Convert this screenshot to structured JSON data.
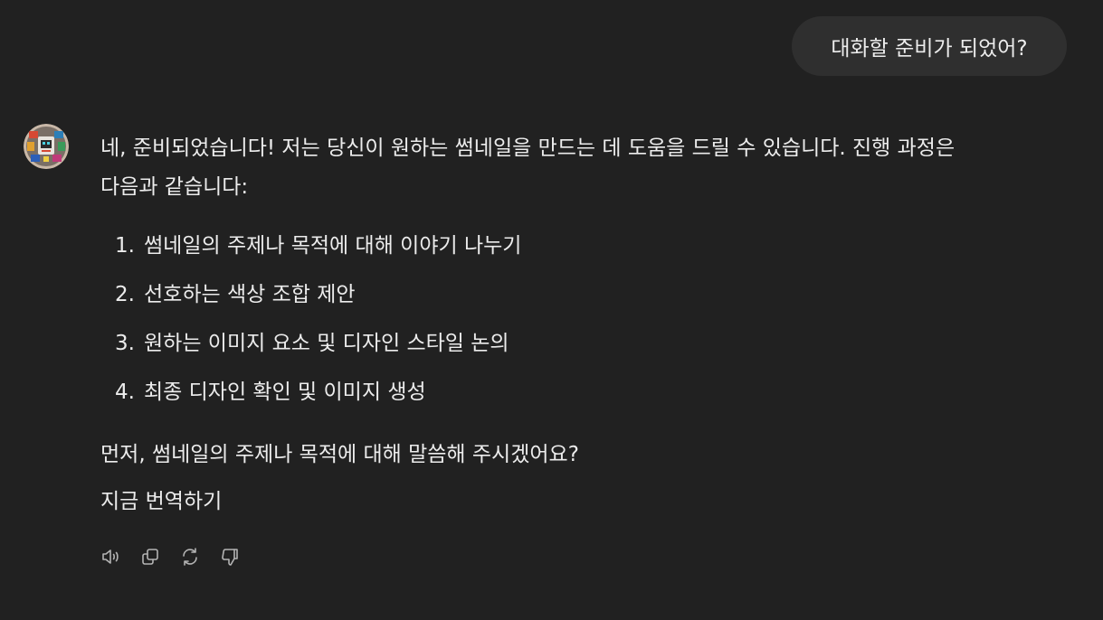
{
  "user_message": "대화할 준비가 되었어?",
  "assistant": {
    "intro_line1": "네, 준비되었습니다! 저는 당신이 원하는 썸네일을 만드는 데 도움을 드릴 수 있습니다. 진행 과정은",
    "intro_line2": "다음과 같습니다:",
    "steps": [
      {
        "num": "1.",
        "text": "썸네일의 주제나 목적에 대해 이야기 나누기"
      },
      {
        "num": "2.",
        "text": "선호하는 색상 조합 제안"
      },
      {
        "num": "3.",
        "text": "원하는 이미지 요소 및 디자인 스타일 논의"
      },
      {
        "num": "4.",
        "text": "최종 디자인 확인 및 이미지 생성"
      }
    ],
    "question": "먼저, 썸네일의 주제나 목적에 대해 말씀해 주시겠어요?",
    "translate": "지금 번역하기"
  },
  "actions": {
    "icons": [
      "speaker-icon",
      "copy-icon",
      "regenerate-icon",
      "thumbs-down-icon"
    ]
  },
  "colors": {
    "background": "#212121",
    "user_bubble": "#2f2f2f",
    "text": "#ececec",
    "icon": "#b4b4b4"
  }
}
